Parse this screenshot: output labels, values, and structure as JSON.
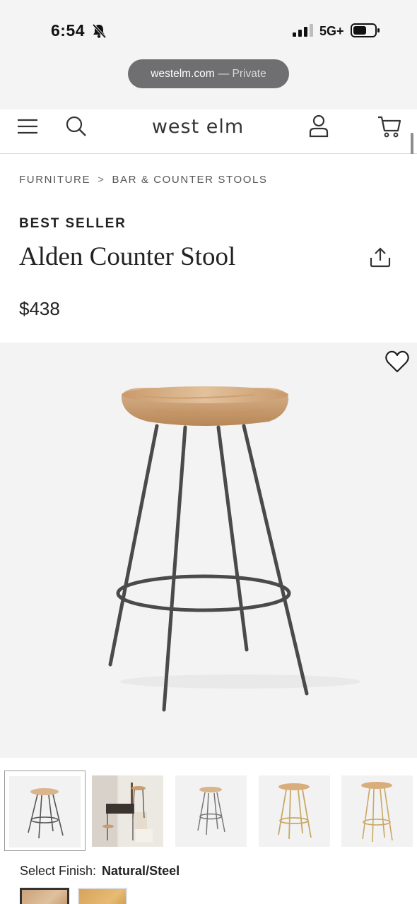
{
  "status_bar": {
    "time": "6:54",
    "network": "5G+",
    "icons": [
      "bell-slash-icon",
      "signal-icon",
      "battery-icon"
    ]
  },
  "browser": {
    "host": "westelm.com",
    "mode": "— Private"
  },
  "header": {
    "logo": "west elm",
    "icons": [
      "menu-icon",
      "search-icon",
      "account-icon",
      "cart-icon"
    ]
  },
  "breadcrumb": {
    "items": [
      "FURNITURE",
      "BAR & COUNTER STOOLS"
    ],
    "separator": ">"
  },
  "product": {
    "badge": "BEST SELLER",
    "title": "Alden Counter Stool",
    "price": "$438"
  },
  "finish": {
    "label": "Select Finish:",
    "value": "Natural/Steel"
  },
  "colors": {
    "wood": "#d9b48d",
    "steel": "#4a4a4a",
    "brass": "#c9a865"
  }
}
